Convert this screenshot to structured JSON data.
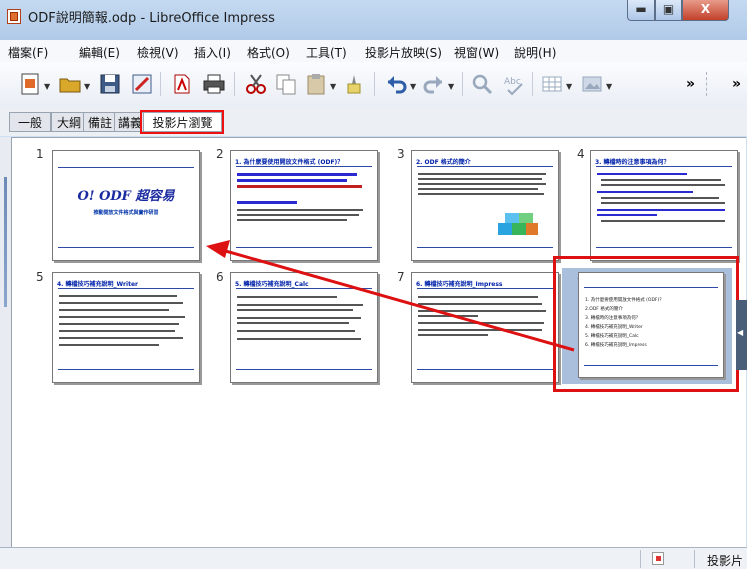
{
  "window": {
    "title": "ODF說明簡報.odp - LibreOffice Impress",
    "minimize": "▬",
    "maximize": "▣",
    "close": "X"
  },
  "menu": [
    "檔案(F)",
    "編輯(E)",
    "檢視(V)",
    "插入(I)",
    "格式(O)",
    "工具(T)",
    "投影片放映(S)",
    "視窗(W)",
    "說明(H)"
  ],
  "toolbar": {
    "icons": [
      "new-icon",
      "open-icon",
      "save-icon",
      "edit-icon",
      "pdf-icon",
      "print-icon",
      "cut-icon",
      "copy-icon",
      "paste-icon",
      "clone-format-icon",
      "undo-icon",
      "redo-icon",
      "find-icon",
      "spellcheck-icon",
      "table-icon",
      "image-icon"
    ],
    "overflow": "»",
    "overflow2": "»"
  },
  "tabs": [
    {
      "label": "一般",
      "active": false
    },
    {
      "label": "大綱",
      "active": false
    },
    {
      "label": "備註",
      "active": false
    },
    {
      "label": "講義",
      "active": false
    },
    {
      "label": "投影片瀏覽",
      "active": true
    }
  ],
  "slides": [
    {
      "num": "1",
      "title": "O! ODF 超容易",
      "subtitle": "推動開放文件格式與實作研習"
    },
    {
      "num": "2",
      "title": "1. 為什麼要使用開放文件格式 (ODF)？"
    },
    {
      "num": "3",
      "title": "2. ODF 格式的簡介"
    },
    {
      "num": "4",
      "title": "3. 轉檔時的注意事項為何？"
    },
    {
      "num": "5",
      "title": "4. 轉檔技巧補充說明_Writer"
    },
    {
      "num": "6",
      "title": "5. 轉檔技巧補充說明_Calc"
    },
    {
      "num": "7",
      "title": "6. 轉檔技巧補充說明_Impress"
    },
    {
      "num": "8",
      "bullets": [
        "1. 為什麼要使用開放文件格式 (ODF)？",
        "2.ODF 格式的簡介",
        "3. 轉檔時的注意事項為何？",
        "4. 轉檔技巧補充說明_Writer",
        "5. 轉檔技巧補充說明_Calc",
        "6. 轉檔技巧補充說明_Impress"
      ]
    }
  ],
  "status": {
    "text": "投影片"
  },
  "colors": {
    "highlight": "#dd1111",
    "titlebar": "#b8cfea"
  }
}
